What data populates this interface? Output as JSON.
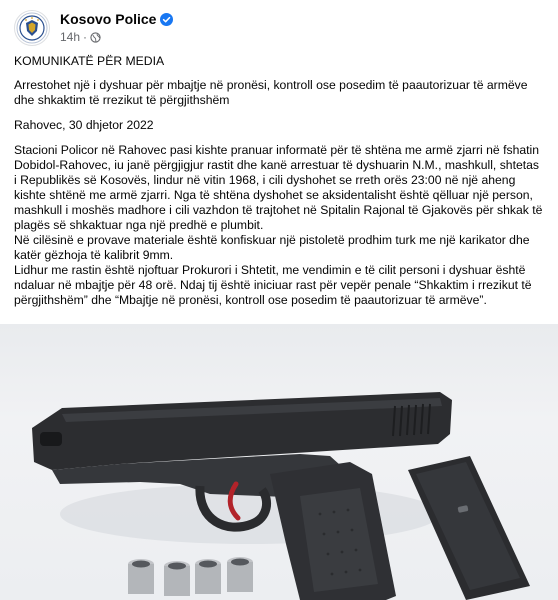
{
  "post": {
    "author": "Kosovo Police",
    "time": "14h",
    "separator": "·",
    "header_title": "KOMUNIKATË PËR MEDIA",
    "headline": "Arrestohet një i dyshuar për mbajtje në pronësi, kontroll ose posedim të paautorizuar të armëve dhe shkaktim të rrezikut të përgjithshëm",
    "dateline": "Rahovec, 30 dhjetor 2022",
    "paragraphs": [
      "Stacioni Policor në Rahovec pasi kishte pranuar informatë për të shtëna me armë zjarri në fshatin Dobidol-Rahovec, iu janë përgjigjur rastit dhe kanë arrestuar të dyshuarin N.M., mashkull, shtetas i Republikës së Kosovës, lindur në vitin 1968, i cili dyshohet se rreth orës 23:00 në një aheng kishte shtënë me armë zjarri. Nga të shtëna dyshohet se aksidentalisht është qëlluar një person, mashkull i moshës madhore i cili vazhdon të trajtohet në Spitalin Rajonal të Gjakovës për shkak të plagës së shkaktuar nga një predhë e plumbit.",
      "Në cilësinë e provave materiale është konfiskuar një pistoletë prodhim turk me një karikator dhe katër gëzhoja të kalibrit 9mm.",
      "Lidhur me rastin është njoftuar Prokurori i Shtetit, me vendimin e të cilit personi i dyshuar është ndaluar në mbajtje për 48 orë. Ndaj tij është iniciuar rast për vepër penale “Shkaktim i rrezikut të përgjithshëm” dhe “Mbajtje në pronësi, kontroll ose posedim të paautorizuar të armëve”."
    ]
  },
  "icons": {
    "avatar": "police-emblem-icon",
    "verified": "verified-badge-icon",
    "audience": "globe-icon"
  },
  "colors": {
    "verified_blue": "#1877f2",
    "meta_gray": "#65676b",
    "text": "#050505"
  }
}
